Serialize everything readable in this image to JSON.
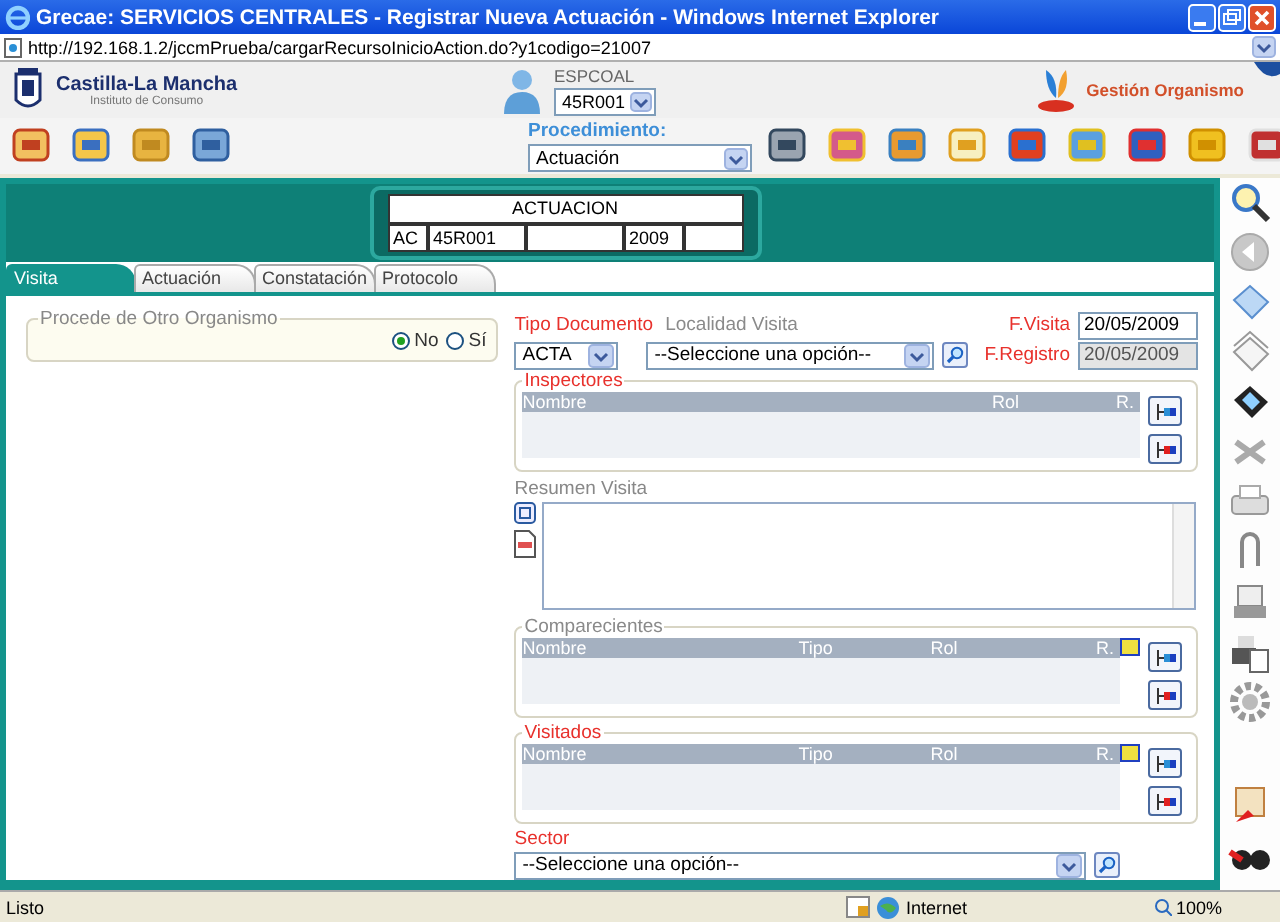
{
  "window": {
    "title": "Grecae: SERVICIOS CENTRALES - Registrar Nueva Actuación - Windows Internet Explorer"
  },
  "address_bar": {
    "url": "http://192.168.1.2/jccmPrueba/cargarRecursoInicioAction.do?y1codigo=21007"
  },
  "header": {
    "logo_title": "Castilla-La Mancha",
    "logo_subtitle": "Instituto de Consumo",
    "user_label": "ESPCOAL",
    "user_select": "45R001",
    "org_link": "Gestión Organismo"
  },
  "toolbar": {
    "procedure_label": "Procedimiento:",
    "procedure_value": "Actuación"
  },
  "record": {
    "title": "ACTUACION",
    "code": "AC",
    "unit": "45R001",
    "year": "2009"
  },
  "tabs": [
    {
      "label": "Visita",
      "selected": true
    },
    {
      "label": "Actuación",
      "selected": false
    },
    {
      "label": "Constatación",
      "selected": false
    },
    {
      "label": "Protocolo",
      "selected": false
    }
  ],
  "origin": {
    "legend": "Procede de Otro Organismo",
    "options": [
      {
        "label": "No",
        "selected": true
      },
      {
        "label": "Sí",
        "selected": false
      }
    ]
  },
  "document_type": {
    "label": "Tipo Documento",
    "required": true,
    "value": "ACTA"
  },
  "locality": {
    "label": "Localidad Visita",
    "required": false,
    "value": "--Seleccione una opción--"
  },
  "visit_date": {
    "label": "F.Visita",
    "required": true,
    "value": "20/05/2009",
    "disabled": false
  },
  "register_date": {
    "label": "F.Registro",
    "required": true,
    "value": "20/05/2009",
    "disabled": true
  },
  "inspectors": {
    "legend": "Inspectores",
    "required": true,
    "columns": [
      "Nombre",
      "Rol",
      "R."
    ]
  },
  "summary": {
    "label": "Resumen Visita"
  },
  "attendees": {
    "legend": "Comparecientes",
    "required": false,
    "columns": [
      "Nombre",
      "Tipo",
      "Rol",
      "R."
    ]
  },
  "visited": {
    "legend": "Visitados",
    "required": true,
    "columns": [
      "Nombre",
      "Tipo",
      "Rol",
      "R."
    ]
  },
  "sector": {
    "label": "Sector",
    "required": true,
    "value": "--Seleccione una opción--"
  },
  "status_bar": {
    "text": "Listo",
    "zone": "Internet",
    "zoom": "100%"
  }
}
